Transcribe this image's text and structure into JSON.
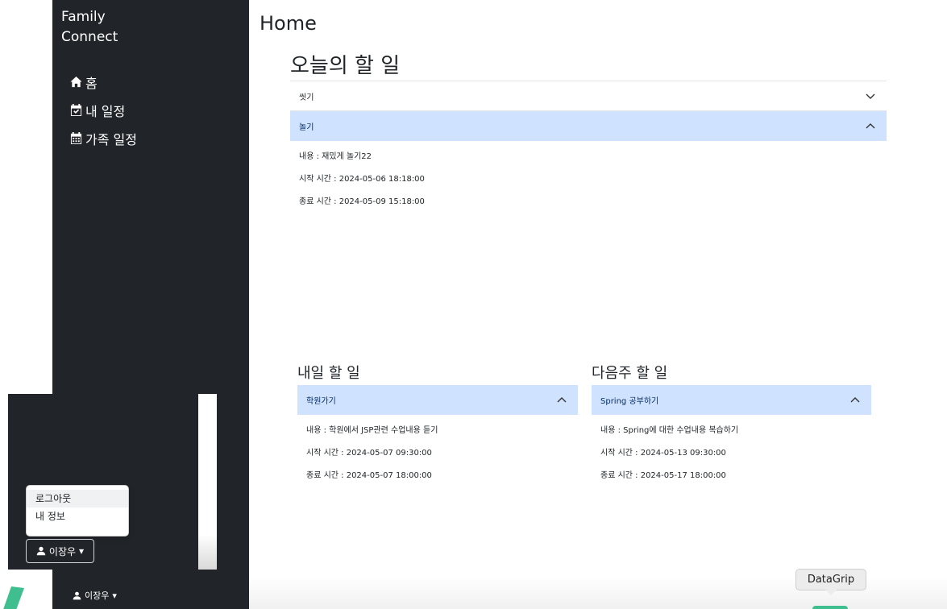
{
  "sidebar": {
    "brand_line1": "Family",
    "brand_line2": "Connect",
    "items": [
      {
        "label": "홈",
        "icon": "home-icon"
      },
      {
        "label": "내 일정",
        "icon": "calendar-check-icon"
      },
      {
        "label": "가족 일정",
        "icon": "calendar-icon"
      }
    ],
    "user_name": "이장우"
  },
  "popup": {
    "menu": [
      "로그아웃",
      "내 정보"
    ],
    "user_name": "이장우"
  },
  "main": {
    "title": "Home",
    "today": {
      "heading": "오늘의 할 일",
      "items": [
        {
          "title": "씻기",
          "open": false
        },
        {
          "title": "놀기",
          "open": true,
          "content": "내용 : 재밌게 놀기22",
          "start": "시작 시간 : 2024-05-06 18:18:00",
          "end": "종료 시간 : 2024-05-09 15:18:00"
        }
      ]
    },
    "tomorrow": {
      "heading": "내일 할 일",
      "item": {
        "title": "학원가기",
        "content": "내용 : 학원에서 JSP관련 수업내용 듣기",
        "start": "시작 시간 : 2024-05-07 09:30:00",
        "end": "종료 시간 : 2024-05-07 18:00:00"
      }
    },
    "next_week": {
      "heading": "다음주 할 일",
      "item": {
        "title": "Spring 공부하기",
        "content": "내용 : Spring에 대한 수업내용 복습하기",
        "start": "시작 시간 : 2024-05-13 09:30:00",
        "end": "종료 시간 : 2024-05-17 18:00:00"
      }
    }
  },
  "dock_tooltip": "DataGrip",
  "colors": {
    "sidebar_bg": "#212529",
    "accordion_open_bg": "#cfe2ff",
    "accent_green": "#3fbf8f"
  }
}
